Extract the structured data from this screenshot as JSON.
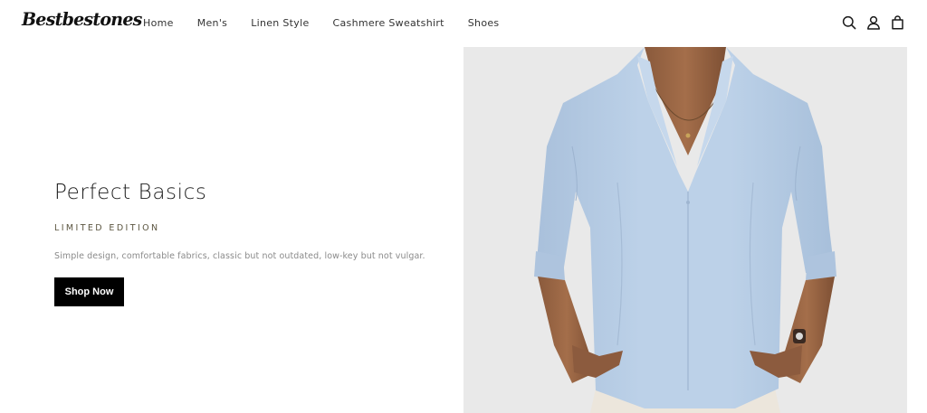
{
  "header": {
    "logo": "Bestbestones",
    "nav": [
      {
        "label": "Home"
      },
      {
        "label": "Men's"
      },
      {
        "label": "Linen Style"
      },
      {
        "label": "Cashmere Sweatshirt"
      },
      {
        "label": "Shoes"
      }
    ],
    "icons": [
      "search-icon",
      "account-icon",
      "cart-icon"
    ]
  },
  "hero": {
    "title": "Perfect Basics",
    "tagline": "LIMITED EDITION",
    "description": "Simple design, comfortable fabrics, classic but not outdated, low-key but not vulgar.",
    "button_label": "Shop Now",
    "image": {
      "subject": "man-in-light-blue-linen-shirt",
      "background_color": "#e9e9e9",
      "shirt_color": "#b7cde4"
    }
  },
  "colors": {
    "text": "#1a1a1a",
    "tagline": "#5b5540",
    "muted": "#8a8a8a",
    "button_bg": "#000000",
    "button_text": "#ffffff"
  }
}
